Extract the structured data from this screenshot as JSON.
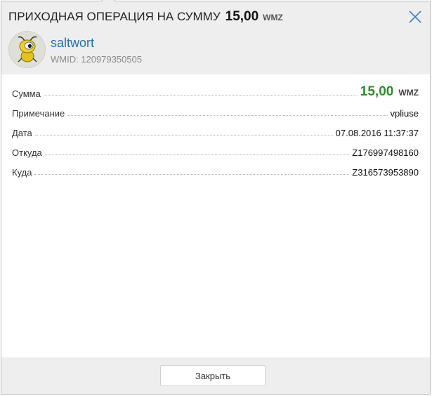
{
  "dialog": {
    "title": "ПРИХОДНАЯ ОПЕРАЦИЯ НА СУММУ",
    "title_amount": "15,00",
    "title_currency": "WMZ",
    "close_icon": "close-icon"
  },
  "user": {
    "name": "saltwort",
    "wmid": "WMID: 120979350505",
    "avatar_icon": "webmoney-bug-avatar"
  },
  "details": {
    "amount_label": "Сумма",
    "amount_value": "15,00",
    "amount_currency": "WMZ",
    "note_label": "Примечание",
    "note_value": "vpliuse",
    "date_label": "Дата",
    "date_value": "07.08.2016 11:37:37",
    "from_label": "Откуда",
    "from_value": "Z176997498160",
    "to_label": "Куда",
    "to_value": "Z316573953890"
  },
  "footer": {
    "close_label": "Закрыть"
  },
  "colors": {
    "amount_green": "#2e8b2e",
    "link_blue": "#1e70c1",
    "header_bg": "#eeeeee"
  }
}
